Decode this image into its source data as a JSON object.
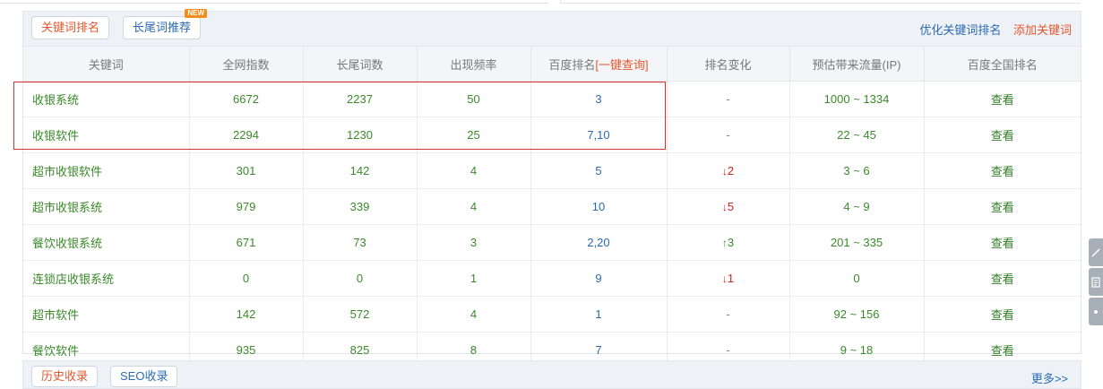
{
  "tabs": {
    "active_label": "关键词排名",
    "second_label": "长尾词推荐",
    "new_badge": "NEW"
  },
  "head_links": {
    "optimize": "优化关键词排名",
    "add": "添加关键词"
  },
  "columns": {
    "keyword": "关键词",
    "index": "全网指数",
    "longtail": "长尾词数",
    "freq": "出现频率",
    "baidu_rank": "百度排名",
    "one_click_query": "[一键查询]",
    "change": "排名变化",
    "traffic": "预估带来流量(IP)",
    "national": "百度全国排名"
  },
  "rows": [
    {
      "keyword": "收银系统",
      "index": "6672",
      "longtail": "2237",
      "freq": "50",
      "rank": "3",
      "change_dir": "none",
      "change": "-",
      "traffic": "1000 ~ 1334",
      "view": "查看"
    },
    {
      "keyword": "收银软件",
      "index": "2294",
      "longtail": "1230",
      "freq": "25",
      "rank": "7,10",
      "change_dir": "none",
      "change": "-",
      "traffic": "22 ~ 45",
      "view": "查看"
    },
    {
      "keyword": "超市收银软件",
      "index": "301",
      "longtail": "142",
      "freq": "4",
      "rank": "5",
      "change_dir": "down",
      "change": "2",
      "traffic": "3 ~ 6",
      "view": "查看"
    },
    {
      "keyword": "超市收银系统",
      "index": "979",
      "longtail": "339",
      "freq": "4",
      "rank": "10",
      "change_dir": "down",
      "change": "5",
      "traffic": "4 ~ 9",
      "view": "查看"
    },
    {
      "keyword": "餐饮收银系统",
      "index": "671",
      "longtail": "73",
      "freq": "3",
      "rank": "2,20",
      "change_dir": "up",
      "change": "3",
      "traffic": "201 ~ 335",
      "view": "查看"
    },
    {
      "keyword": "连锁店收银系统",
      "index": "0",
      "longtail": "0",
      "freq": "1",
      "rank": "9",
      "change_dir": "down",
      "change": "1",
      "traffic": "0",
      "view": "查看"
    },
    {
      "keyword": "超市软件",
      "index": "142",
      "longtail": "572",
      "freq": "4",
      "rank": "1",
      "change_dir": "none",
      "change": "-",
      "traffic": "92 ~ 156",
      "view": "查看"
    },
    {
      "keyword": "餐饮软件",
      "index": "935",
      "longtail": "825",
      "freq": "8",
      "rank": "7",
      "change_dir": "none",
      "change": "-",
      "traffic": "9 ~ 18",
      "view": "查看"
    }
  ],
  "bottom_panel": {
    "tab1": "历史收录",
    "tab2": "SEO收录",
    "more": "更多>>"
  },
  "colors": {
    "accent_red": "#e4572e",
    "link_blue": "#2a6ab3",
    "value_green": "#3a8a2a",
    "highlight_border": "#d8302c"
  }
}
